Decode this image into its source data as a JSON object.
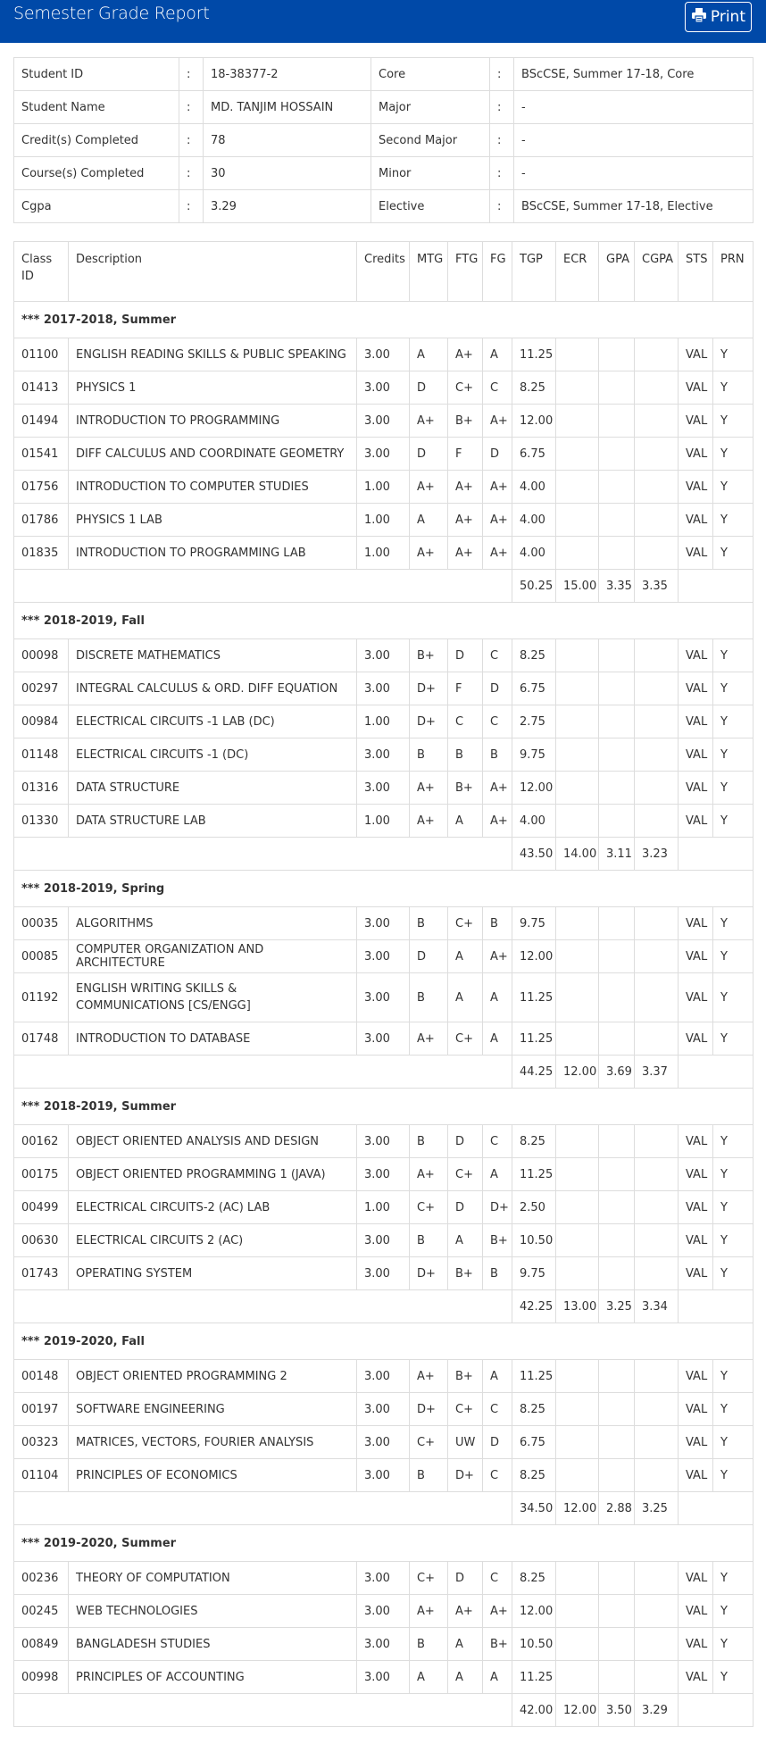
{
  "header": {
    "title": "Semester Grade Report",
    "print_label": "Print"
  },
  "info": [
    {
      "l_label": "Student ID",
      "l_value": "18-38377-2",
      "r_label": "Core",
      "r_value": "BScCSE, Summer 17-18, Core"
    },
    {
      "l_label": "Student Name",
      "l_value": "MD. TANJIM HOSSAIN",
      "r_label": "Major",
      "r_value": "-"
    },
    {
      "l_label": "Credit(s) Completed",
      "l_value": "78",
      "r_label": "Second Major",
      "r_value": "-"
    },
    {
      "l_label": "Course(s) Completed",
      "l_value": "30",
      "r_label": "Minor",
      "r_value": "-"
    },
    {
      "l_label": "Cgpa",
      "l_value": "3.29",
      "r_label": "Elective",
      "r_value": "BScCSE, Summer 17-18, Elective"
    }
  ],
  "colon": ":",
  "columns": [
    "Class ID",
    "Description",
    "Credits",
    "MTG",
    "FTG",
    "FG",
    "TGP",
    "ECR",
    "GPA",
    "CGPA",
    "STS",
    "PRN"
  ],
  "terms": [
    {
      "name": "*** 2017-2018, Summer",
      "courses": [
        [
          "01100",
          "ENGLISH READING SKILLS & PUBLIC SPEAKING",
          "3.00",
          "A",
          "A+",
          "A",
          "11.25",
          "VAL",
          "Y"
        ],
        [
          "01413",
          "PHYSICS 1",
          "3.00",
          "D",
          "C+",
          "C",
          "8.25",
          "VAL",
          "Y"
        ],
        [
          "01494",
          "INTRODUCTION TO PROGRAMMING",
          "3.00",
          "A+",
          "B+",
          "A+",
          "12.00",
          "VAL",
          "Y"
        ],
        [
          "01541",
          "DIFF CALCULUS AND COORDINATE GEOMETRY",
          "3.00",
          "D",
          "F",
          "D",
          "6.75",
          "VAL",
          "Y"
        ],
        [
          "01756",
          "INTRODUCTION TO COMPUTER STUDIES",
          "1.00",
          "A+",
          "A+",
          "A+",
          "4.00",
          "VAL",
          "Y"
        ],
        [
          "01786",
          "PHYSICS 1 LAB",
          "1.00",
          "A",
          "A+",
          "A+",
          "4.00",
          "VAL",
          "Y"
        ],
        [
          "01835",
          "INTRODUCTION TO PROGRAMMING LAB",
          "1.00",
          "A+",
          "A+",
          "A+",
          "4.00",
          "VAL",
          "Y"
        ]
      ],
      "summary": [
        "50.25",
        "15.00",
        "3.35",
        "3.35"
      ]
    },
    {
      "name": "*** 2018-2019, Fall",
      "courses": [
        [
          "00098",
          "DISCRETE MATHEMATICS",
          "3.00",
          "B+",
          "D",
          "C",
          "8.25",
          "VAL",
          "Y"
        ],
        [
          "00297",
          "INTEGRAL CALCULUS & ORD. DIFF EQUATION",
          "3.00",
          "D+",
          "F",
          "D",
          "6.75",
          "VAL",
          "Y"
        ],
        [
          "00984",
          "ELECTRICAL CIRCUITS -1 LAB (DC)",
          "1.00",
          "D+",
          "C",
          "C",
          "2.75",
          "VAL",
          "Y"
        ],
        [
          "01148",
          "ELECTRICAL CIRCUITS -1 (DC)",
          "3.00",
          "B",
          "B",
          "B",
          "9.75",
          "VAL",
          "Y"
        ],
        [
          "01316",
          "DATA STRUCTURE",
          "3.00",
          "A+",
          "B+",
          "A+",
          "12.00",
          "VAL",
          "Y"
        ],
        [
          "01330",
          "DATA STRUCTURE LAB",
          "1.00",
          "A+",
          "A",
          "A+",
          "4.00",
          "VAL",
          "Y"
        ]
      ],
      "summary": [
        "43.50",
        "14.00",
        "3.11",
        "3.23"
      ]
    },
    {
      "name": "*** 2018-2019, Spring",
      "courses": [
        [
          "00035",
          "ALGORITHMS",
          "3.00",
          "B",
          "C+",
          "B",
          "9.75",
          "VAL",
          "Y"
        ],
        [
          "00085",
          "COMPUTER ORGANIZATION AND ARCHITECTURE",
          "3.00",
          "D",
          "A",
          "A+",
          "12.00",
          "VAL",
          "Y"
        ],
        [
          "01192",
          "ENGLISH WRITING SKILLS & COMMUNICATIONS [CS/ENGG]",
          "3.00",
          "B",
          "A",
          "A",
          "11.25",
          "VAL",
          "Y"
        ],
        [
          "01748",
          "INTRODUCTION TO DATABASE",
          "3.00",
          "A+",
          "C+",
          "A",
          "11.25",
          "VAL",
          "Y"
        ]
      ],
      "summary": [
        "44.25",
        "12.00",
        "3.69",
        "3.37"
      ]
    },
    {
      "name": "*** 2018-2019, Summer",
      "courses": [
        [
          "00162",
          "OBJECT ORIENTED ANALYSIS AND DESIGN",
          "3.00",
          "B",
          "D",
          "C",
          "8.25",
          "VAL",
          "Y"
        ],
        [
          "00175",
          "OBJECT ORIENTED PROGRAMMING 1 (JAVA)",
          "3.00",
          "A+",
          "C+",
          "A",
          "11.25",
          "VAL",
          "Y"
        ],
        [
          "00499",
          "ELECTRICAL CIRCUITS-2 (AC) LAB",
          "1.00",
          "C+",
          "D",
          "D+",
          "2.50",
          "VAL",
          "Y"
        ],
        [
          "00630",
          "ELECTRICAL CIRCUITS 2 (AC)",
          "3.00",
          "B",
          "A",
          "B+",
          "10.50",
          "VAL",
          "Y"
        ],
        [
          "01743",
          "OPERATING SYSTEM",
          "3.00",
          "D+",
          "B+",
          "B",
          "9.75",
          "VAL",
          "Y"
        ]
      ],
      "summary": [
        "42.25",
        "13.00",
        "3.25",
        "3.34"
      ]
    },
    {
      "name": "*** 2019-2020, Fall",
      "courses": [
        [
          "00148",
          "OBJECT ORIENTED PROGRAMMING 2",
          "3.00",
          "A+",
          "B+",
          "A",
          "11.25",
          "VAL",
          "Y"
        ],
        [
          "00197",
          "SOFTWARE ENGINEERING",
          "3.00",
          "D+",
          "C+",
          "C",
          "8.25",
          "VAL",
          "Y"
        ],
        [
          "00323",
          "MATRICES, VECTORS, FOURIER ANALYSIS",
          "3.00",
          "C+",
          "UW",
          "D",
          "6.75",
          "VAL",
          "Y"
        ],
        [
          "01104",
          "PRINCIPLES OF ECONOMICS",
          "3.00",
          "B",
          "D+",
          "C",
          "8.25",
          "VAL",
          "Y"
        ]
      ],
      "summary": [
        "34.50",
        "12.00",
        "2.88",
        "3.25"
      ]
    },
    {
      "name": "*** 2019-2020, Summer",
      "courses": [
        [
          "00236",
          "THEORY OF COMPUTATION",
          "3.00",
          "C+",
          "D",
          "C",
          "8.25",
          "VAL",
          "Y"
        ],
        [
          "00245",
          "WEB TECHNOLOGIES",
          "3.00",
          "A+",
          "A+",
          "A+",
          "12.00",
          "VAL",
          "Y"
        ],
        [
          "00849",
          "BANGLADESH STUDIES",
          "3.00",
          "B",
          "A",
          "B+",
          "10.50",
          "VAL",
          "Y"
        ],
        [
          "00998",
          "PRINCIPLES OF ACCOUNTING",
          "3.00",
          "A",
          "A",
          "A",
          "11.25",
          "VAL",
          "Y"
        ]
      ],
      "summary": [
        "42.00",
        "12.00",
        "3.50",
        "3.29"
      ]
    }
  ]
}
